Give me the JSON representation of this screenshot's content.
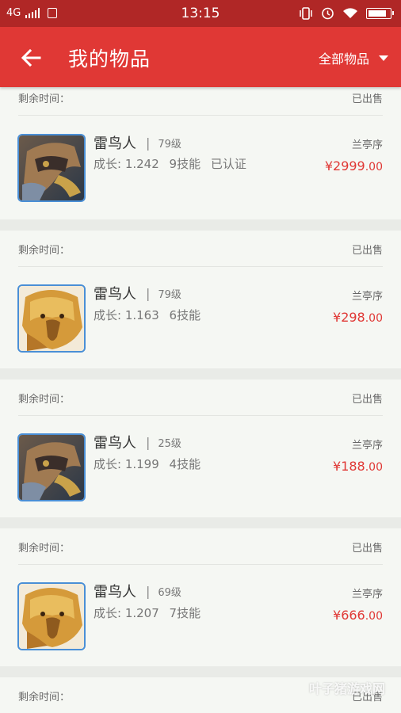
{
  "status_bar": {
    "network": "4G",
    "time": "13:15",
    "battery_level": 0.85
  },
  "header": {
    "title": "我的物品",
    "filter_label": "全部物品",
    "colors": {
      "header_bg": "#e03835",
      "status_bg": "#b02726",
      "price": "#e03835"
    }
  },
  "items": [
    {
      "time_label": "剩余时间：",
      "status": "已出售",
      "name": "雷鸟人",
      "level": "79级",
      "growth": "成长: 1.242",
      "skills": "9技能",
      "certified": "已认证",
      "server": "兰亭序",
      "price_int": "¥2999",
      "price_dec": ".00",
      "avatar_icon": "thunderbird-dark-icon"
    },
    {
      "time_label": "剩余时间：",
      "status": "已出售",
      "name": "雷鸟人",
      "level": "79级",
      "growth": "成长: 1.163",
      "skills": "6技能",
      "certified": "",
      "server": "兰亭序",
      "price_int": "¥298",
      "price_dec": ".00",
      "avatar_icon": "thunderbird-gold-icon"
    },
    {
      "time_label": "剩余时间：",
      "status": "已出售",
      "name": "雷鸟人",
      "level": "25级",
      "growth": "成长: 1.199",
      "skills": "4技能",
      "certified": "",
      "server": "兰亭序",
      "price_int": "¥188",
      "price_dec": ".00",
      "avatar_icon": "thunderbird-dark-icon"
    },
    {
      "time_label": "剩余时间：",
      "status": "已出售",
      "name": "雷鸟人",
      "level": "69级",
      "growth": "成长: 1.207",
      "skills": "7技能",
      "certified": "",
      "server": "兰亭序",
      "price_int": "¥666",
      "price_dec": ".00",
      "avatar_icon": "thunderbird-gold-icon"
    },
    {
      "time_label": "剩余时间：",
      "status": "已出售"
    }
  ],
  "watermark": "叶子猪游戏网"
}
